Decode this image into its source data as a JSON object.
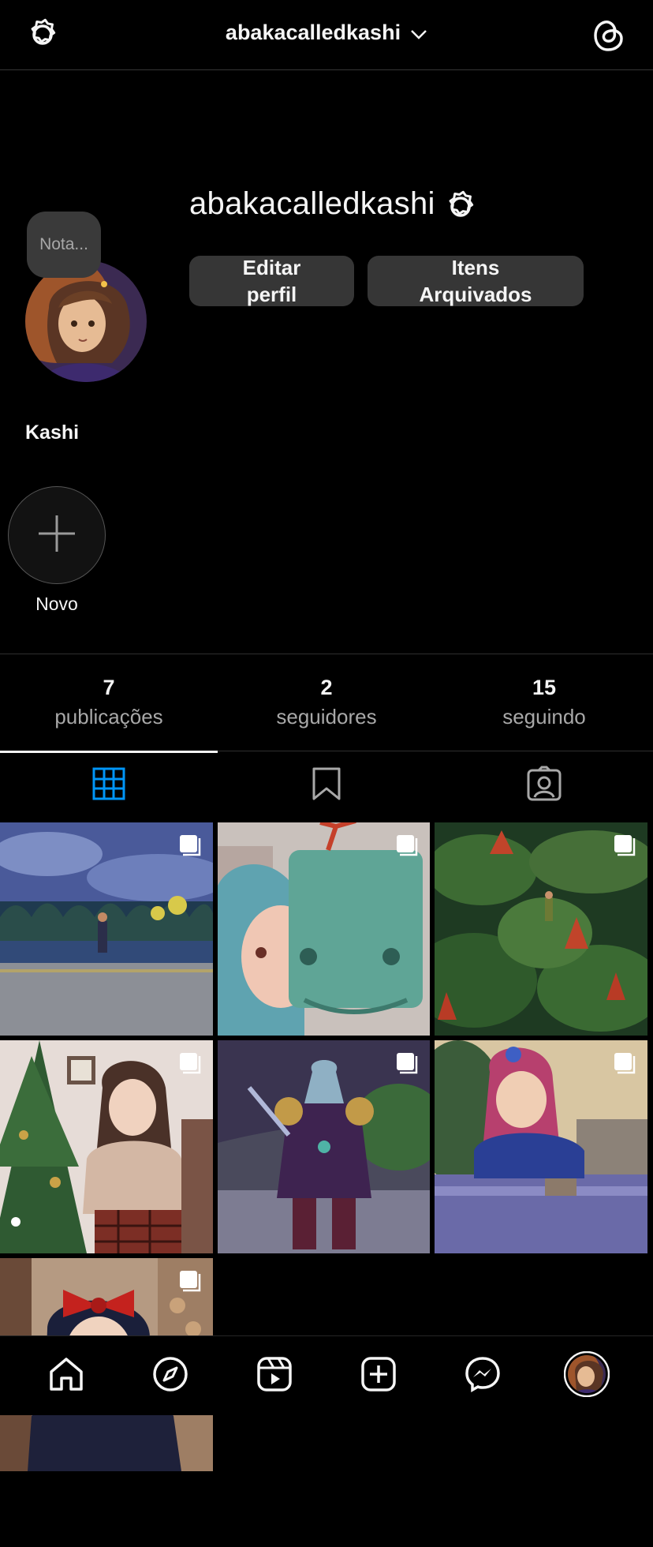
{
  "header": {
    "username": "abakacalledkashi"
  },
  "profile": {
    "username": "abakacalledkashi",
    "display_name": "Kashi",
    "note_placeholder": "Nota...",
    "edit_profile_label": "Editar\nperfil",
    "archived_label": "Itens\nArquivados"
  },
  "highlights": {
    "new_label": "Novo"
  },
  "stats": [
    {
      "count": "7",
      "label": "publicações"
    },
    {
      "count": "2",
      "label": "seguidores"
    },
    {
      "count": "15",
      "label": "seguindo"
    }
  ],
  "tabs": [
    "grid-icon",
    "saved-icon",
    "tagged-icon"
  ],
  "posts": [
    {
      "name": "post-night-park",
      "multi": true
    },
    {
      "name": "post-teal-girl-robot",
      "multi": true
    },
    {
      "name": "post-giant-plants",
      "multi": true
    },
    {
      "name": "post-christmas-tree-girl",
      "multi": true
    },
    {
      "name": "post-armored-warrior",
      "multi": true
    },
    {
      "name": "post-pink-hair-counter",
      "multi": true
    },
    {
      "name": "post-red-bow-bakery",
      "multi": true
    }
  ],
  "bottom_nav": [
    "home-icon",
    "explore-icon",
    "reels-icon",
    "create-icon",
    "messenger-icon",
    "profile-avatar"
  ],
  "colors": {
    "background": "#000000",
    "active_tab": "#0095f6",
    "button": "#363636"
  }
}
